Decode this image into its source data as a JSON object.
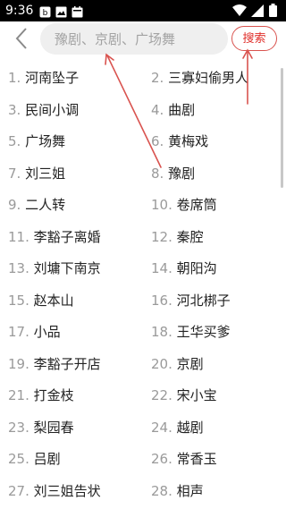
{
  "status_bar": {
    "time": "9:36",
    "left_icons": [
      "notification-icon",
      "image-icon",
      "calendar-icon"
    ],
    "right_icons": [
      "wifi-icon",
      "signal-icon",
      "battery-icon"
    ]
  },
  "header": {
    "back_icon": "chevron-left-icon",
    "search_placeholder": "豫剧、京剧、广场舞",
    "search_button_label": "搜索"
  },
  "list": {
    "items": [
      {
        "num": "1.",
        "title": "河南坠子"
      },
      {
        "num": "2.",
        "title": "三寡妇偷男人"
      },
      {
        "num": "3.",
        "title": "民间小调"
      },
      {
        "num": "4.",
        "title": "曲剧"
      },
      {
        "num": "5.",
        "title": "广场舞"
      },
      {
        "num": "6.",
        "title": "黄梅戏"
      },
      {
        "num": "7.",
        "title": "刘三姐"
      },
      {
        "num": "8.",
        "title": "豫剧"
      },
      {
        "num": "9.",
        "title": "二人转"
      },
      {
        "num": "10.",
        "title": "卷席筒"
      },
      {
        "num": "11.",
        "title": "李豁子离婚"
      },
      {
        "num": "12.",
        "title": "秦腔"
      },
      {
        "num": "13.",
        "title": "刘墉下南京"
      },
      {
        "num": "14.",
        "title": "朝阳沟"
      },
      {
        "num": "15.",
        "title": "赵本山"
      },
      {
        "num": "16.",
        "title": "河北梆子"
      },
      {
        "num": "17.",
        "title": "小品"
      },
      {
        "num": "18.",
        "title": "王华买爹"
      },
      {
        "num": "19.",
        "title": "李豁子开店"
      },
      {
        "num": "20.",
        "title": "京剧"
      },
      {
        "num": "21.",
        "title": "打金枝"
      },
      {
        "num": "22.",
        "title": "宋小宝"
      },
      {
        "num": "23.",
        "title": "梨园春"
      },
      {
        "num": "24.",
        "title": "越剧"
      },
      {
        "num": "25.",
        "title": "吕剧"
      },
      {
        "num": "26.",
        "title": "常香玉"
      },
      {
        "num": "27.",
        "title": "刘三姐告状"
      },
      {
        "num": "28.",
        "title": "相声"
      }
    ]
  },
  "annotation": {
    "color": "#d9534f"
  },
  "colors": {
    "accent": "#e0302b",
    "number": "#9a9a9a",
    "text": "#222222"
  }
}
